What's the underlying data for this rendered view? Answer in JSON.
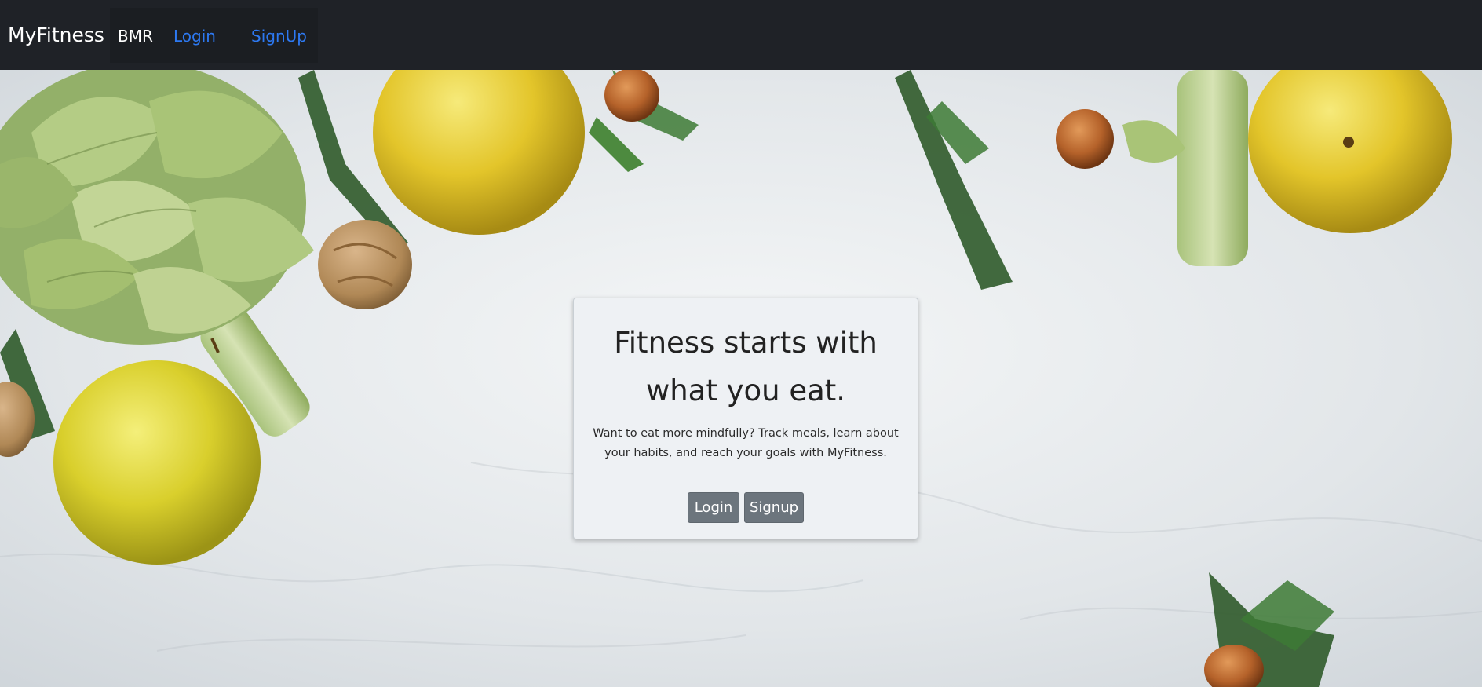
{
  "navbar": {
    "brand": "MyFitness",
    "links": {
      "bmr": "BMR",
      "login": "Login",
      "signup": "SignUp"
    }
  },
  "hero": {
    "background_description_icon": "food-background-image",
    "card": {
      "title": "Fitness starts with what you eat.",
      "text": "Want to eat more mindfully? Track meals, learn about your habits, and reach your goals with MyFitness.",
      "login_button": "Login",
      "signup_button": "Signup"
    }
  },
  "colors": {
    "navbar_bg": "#1f2227",
    "link_blue": "#2d79f2",
    "button_gray": "#6c757d",
    "card_bg": "#eef1f4"
  }
}
